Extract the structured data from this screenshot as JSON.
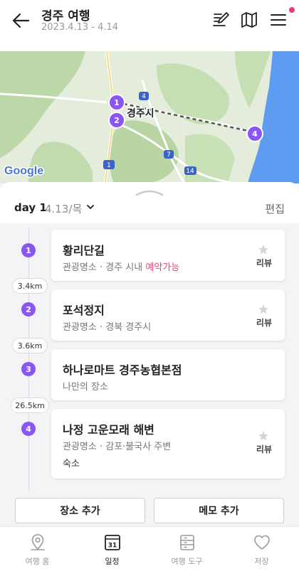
{
  "header": {
    "title": "경주 여행",
    "dates": "2023.4.13 - 4.14"
  },
  "map": {
    "city_label": "경주시",
    "google_label": "Google",
    "road_labels": [
      "4",
      "7",
      "14",
      "1"
    ],
    "markers": [
      "1",
      "2",
      "4"
    ]
  },
  "day": {
    "label": "day 1",
    "date": "4.13/목",
    "edit_label": "편집"
  },
  "places": [
    {
      "num": "1",
      "name": "황리단길",
      "category": "관광명소 · 경주 시내 ",
      "badge": "예약가능",
      "review": "리뷰",
      "extra": ""
    },
    {
      "num": "2",
      "name": "포석정지",
      "category": "관광명소 · 경북 경주시",
      "badge": "",
      "review": "리뷰",
      "extra": ""
    },
    {
      "num": "3",
      "name": "하나로마트 경주농협본점",
      "category": "나만의 장소",
      "badge": "",
      "review": "",
      "extra": ""
    },
    {
      "num": "4",
      "name": "나정 고운모래 해변",
      "category": "관광명소 · 감포·불국사 주변",
      "badge": "",
      "review": "리뷰",
      "extra": "숙소"
    }
  ],
  "distances": [
    "3.4km",
    "3.6km",
    "26.5km"
  ],
  "actions": {
    "add_place": "장소 추가",
    "add_memo": "메모 추가"
  },
  "nav": [
    {
      "label": "여행 홈",
      "icon": "map-pin-icon"
    },
    {
      "label": "일정",
      "icon": "calendar-icon",
      "calendar_day": "31"
    },
    {
      "label": "여행 도구",
      "icon": "tools-icon"
    },
    {
      "label": "저장",
      "icon": "heart-icon"
    }
  ],
  "colors": {
    "accent": "#8b54f6",
    "highlight": "#e8477e",
    "notification": "#ef3d6e"
  }
}
